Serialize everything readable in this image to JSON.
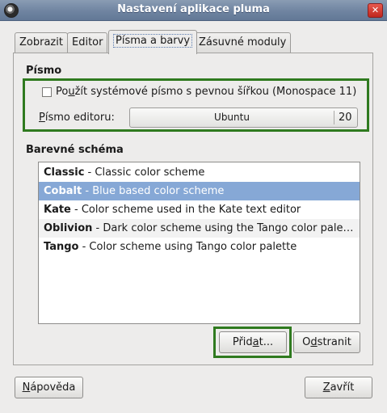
{
  "window": {
    "title": "Nastavení aplikace pluma",
    "close_glyph": "✕",
    "icon": "pluma-app-icon"
  },
  "tabs": [
    {
      "label": "Zobrazit",
      "active": false
    },
    {
      "label": "Editor",
      "active": false
    },
    {
      "label": "Písma a barvy",
      "active": true
    },
    {
      "label": "Zásuvné moduly",
      "active": false
    }
  ],
  "font_section": {
    "title": "Písmo",
    "use_system_font": {
      "checked": false,
      "label_pre": "Po",
      "label_mnemonic": "u",
      "label_post": "žít systémové písmo s pevnou šířkou (Monospace 11)"
    },
    "editor_font": {
      "label_mnemonic": "P",
      "label_post": "ísmo editoru:",
      "font_name": "Ubuntu",
      "font_size": "20"
    }
  },
  "scheme_section": {
    "title": "Barevné schéma",
    "schemes": [
      {
        "name": "Classic",
        "desc": " - Classic color scheme",
        "selected": false
      },
      {
        "name": "Cobalt",
        "desc": " - Blue based color scheme",
        "selected": true
      },
      {
        "name": "Kate",
        "desc": " - Color scheme used in the Kate text editor",
        "selected": false
      },
      {
        "name": "Oblivion",
        "desc": " - Dark color scheme using the Tango color pale…",
        "selected": false
      },
      {
        "name": "Tango",
        "desc": " - Color scheme using Tango color palette",
        "selected": false
      }
    ],
    "add_button": {
      "pre": "Přid",
      "mnemonic": "a",
      "post": "t..."
    },
    "remove_button": {
      "pre": "O",
      "mnemonic": "d",
      "post": "stranit"
    }
  },
  "footer": {
    "help_button": {
      "mnemonic": "N",
      "post": "ápověda"
    },
    "close_button": {
      "mnemonic": "Z",
      "post": "avřít"
    }
  },
  "colors": {
    "highlight_outline": "#2f7a1f",
    "selection": "#86a8d6",
    "titlebar": "#6f84a1"
  }
}
